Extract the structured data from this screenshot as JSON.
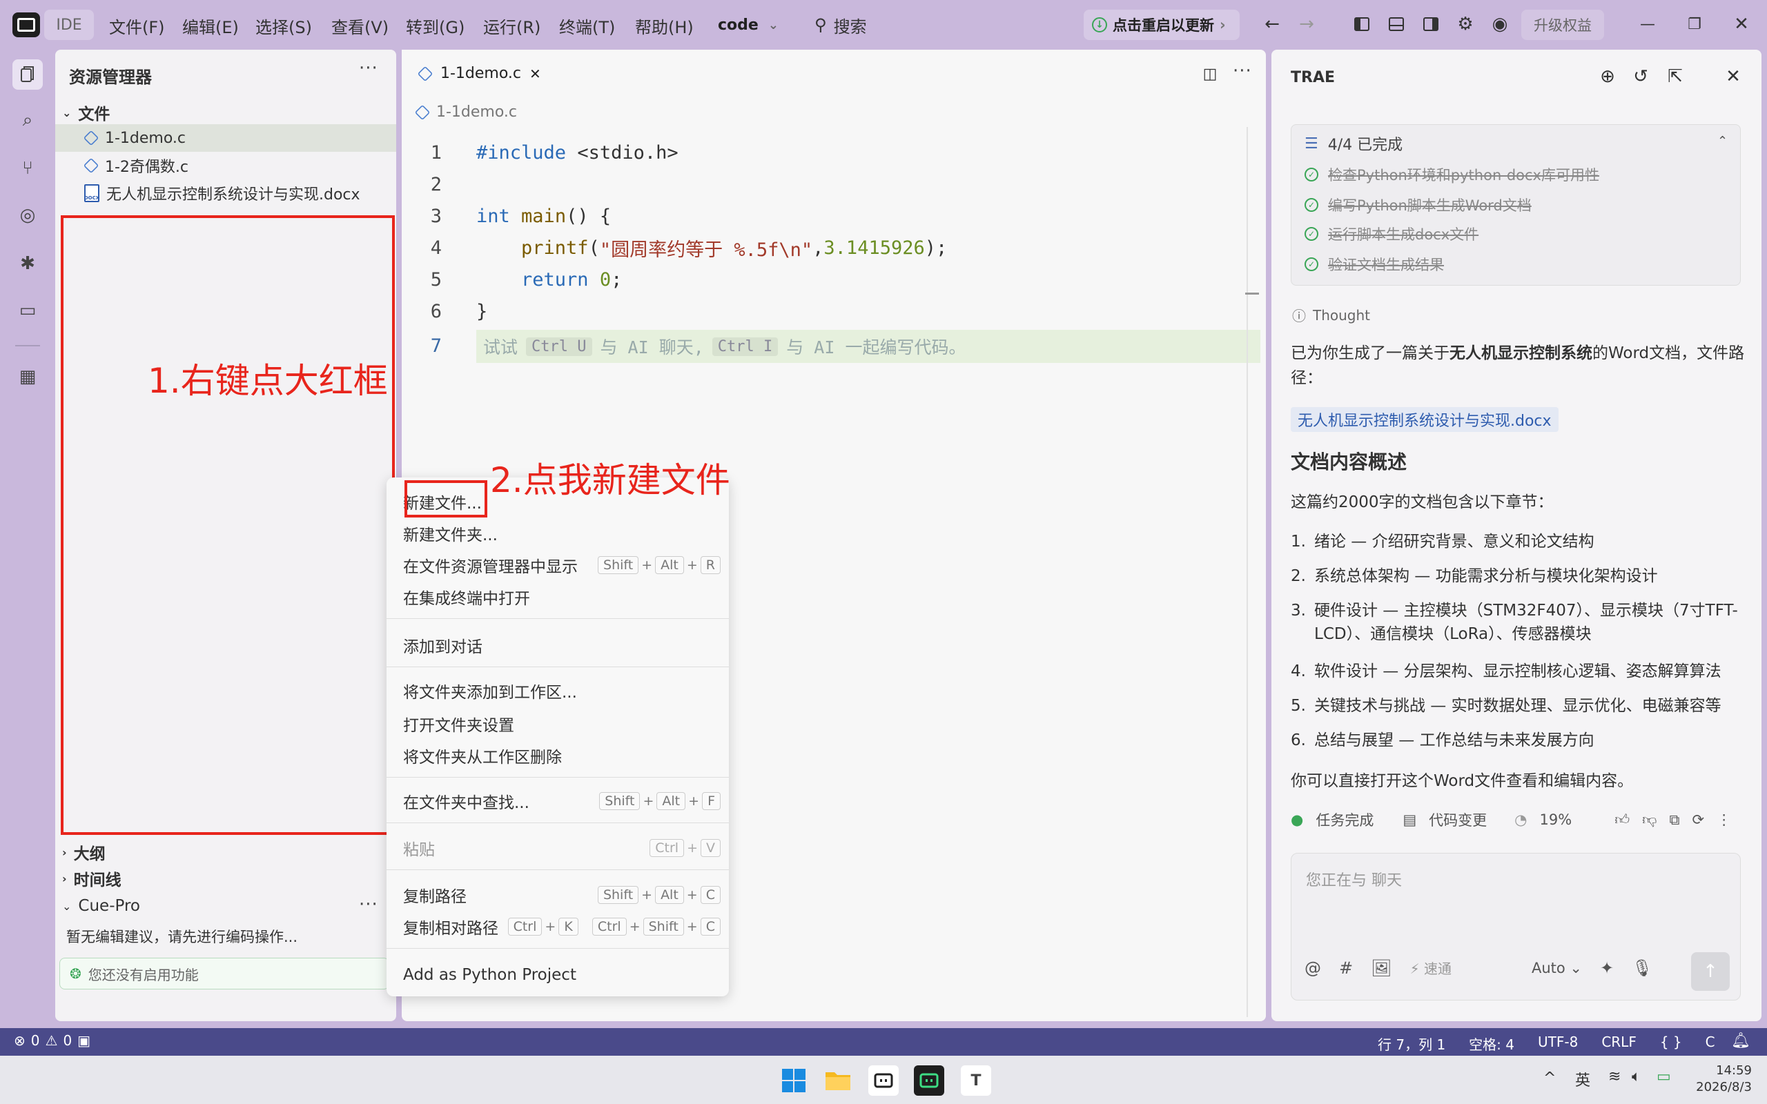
{
  "titlebar": {
    "ide_label": "IDE",
    "menus": [
      "文件(F)",
      "编辑(E)",
      "选择(S)",
      "查看(V)",
      "转到(G)",
      "运行(R)",
      "终端(T)",
      "帮助(H)"
    ],
    "workspace": "code",
    "search": "搜索",
    "update": "点击重启以更新",
    "upgrade": "升级权益"
  },
  "explorer": {
    "title": "资源管理器",
    "folder": "文件",
    "files": [
      "1-1demo.c",
      "1-2奇偶数.c",
      "无人机显示控制系统设计与实现.docx"
    ],
    "outline": "大纲",
    "timeline": "时间线",
    "cue": "Cue-Pro",
    "cue_msg": "暂无编辑建议，请先进行编码操作...",
    "cue_btn": "您还没有启用功能"
  },
  "annotations": {
    "a1": "1.右键点大红框",
    "a2": "2.点我新建文件"
  },
  "editor": {
    "tab": "1-1demo.c",
    "breadcrumb": "1-1demo.c",
    "hint": {
      "a": "试试",
      "k1": "Ctrl U",
      "b": "与 AI 聊天,",
      "k2": "Ctrl I",
      "c": "与 AI 一起编写代码。"
    }
  },
  "context_menu": {
    "new_file": "新建文件...",
    "new_folder": "新建文件夹...",
    "reveal": "在文件资源管理器中显示",
    "open_terminal": "在集成终端中打开",
    "add_chat": "添加到对话",
    "add_workspace": "将文件夹添加到工作区...",
    "folder_settings": "打开文件夹设置",
    "remove_folder": "将文件夹从工作区删除",
    "find_in_folder": "在文件夹中查找...",
    "paste": "粘贴",
    "copy_path": "复制路径",
    "copy_rel_path": "复制相对路径",
    "python": "Add as Python Project"
  },
  "trae": {
    "title": "TRAE",
    "task_header": "4/4 已完成",
    "tasks": [
      "检查Python环境和python-docx库可用性",
      "编写Python脚本生成Word文档",
      "运行脚本生成docx文件",
      "验证文档生成结果"
    ],
    "thought": "Thought",
    "intro_a": "已为你生成了一篇关于",
    "intro_b": "无人机显示控制系统",
    "intro_c": "的Word文档，文件路径：",
    "file_link": "无人机显示控制系统设计与实现.docx",
    "h2": "文档内容概述",
    "summary": "这篇约2000字的文档包含以下章节：",
    "sections": [
      {
        "n": "1.",
        "t": "绪论 — 介绍研究背景、意义和论文结构"
      },
      {
        "n": "2.",
        "t": "系统总体架构 — 功能需求分析与模块化架构设计"
      },
      {
        "n": "3.",
        "t": "硬件设计 — 主控模块（STM32F407）、显示模块（7寸TFT-LCD）、通信模块（LoRa）、传感器模块"
      },
      {
        "n": "4.",
        "t": "软件设计 — 分层架构、显示控制核心逻辑、姿态解算算法"
      },
      {
        "n": "5.",
        "t": "关键技术与挑战 — 实时数据处理、显示优化、电磁兼容等"
      },
      {
        "n": "6.",
        "t": "总结与展望 — 工作总结与未来发展方向"
      }
    ],
    "closing": "你可以直接打开这个Word文件查看和编辑内容。",
    "task_done": "任务完成",
    "code_change": "代码变更",
    "percent": "19%",
    "chat_placeholder": "您正在与 聊天",
    "speed": "速通",
    "mode": "Auto"
  },
  "statusbar": {
    "errors": "0",
    "warnings": "0",
    "position": "行 7，列 1",
    "spaces": "空格: 4",
    "encoding": "UTF-8",
    "eol": "CRLF",
    "braces": "{ }",
    "lang": "C"
  },
  "taskbar": {
    "ime": "英",
    "time": "14:59",
    "date": "2026/8/3"
  }
}
